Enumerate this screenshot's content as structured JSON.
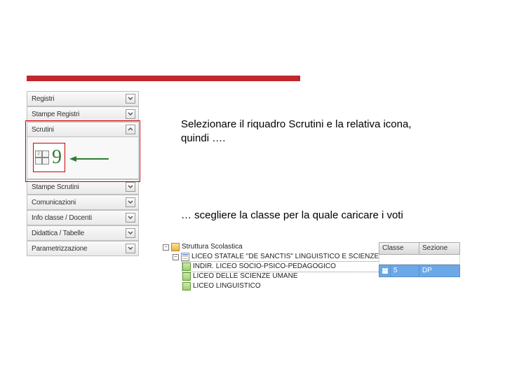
{
  "sidebar": {
    "items": [
      {
        "label": "Registri"
      },
      {
        "label": "Stampe Registri"
      },
      {
        "label": "Scrutini"
      },
      {
        "label": "Stampe Scrutini"
      },
      {
        "label": "Comunicazioni"
      },
      {
        "label": "Info classe / Docenti"
      },
      {
        "label": "Didattica / Tabelle"
      },
      {
        "label": "Parametrizzazione"
      }
    ],
    "grade_icon_digit": "9"
  },
  "instructions": {
    "a": "Selezionare il riquadro Scrutini e la relativa icona, quindi ….",
    "b": "… scegliere la classe per la quale caricare i voti"
  },
  "tree": {
    "root": "Struttura Scolastica",
    "school": "LICEO STATALE \"DE SANCTIS\" LINGUISTICO E SCIENZE UMANE",
    "branches": [
      "INDIR. LICEO SOCIO-PSICO-PEDAGOGICO",
      "LICEO DELLE SCIENZE UMANE",
      "LICEO LINGUISTICO"
    ]
  },
  "class_table": {
    "headers": {
      "classe": "Classe",
      "sezione": "Sezione"
    },
    "row": {
      "classe": "5",
      "sezione": "DP"
    }
  }
}
